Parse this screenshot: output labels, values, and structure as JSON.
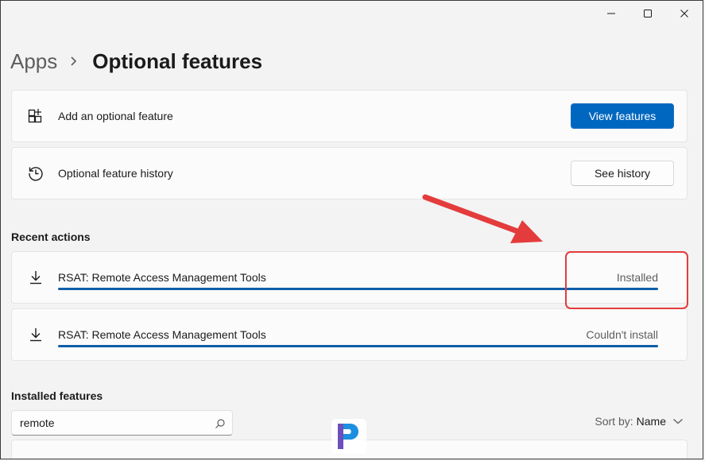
{
  "window": {
    "controls": [
      "minimize",
      "maximize",
      "close"
    ]
  },
  "breadcrumb": {
    "parent": "Apps",
    "separator_icon": "chevron-right-icon",
    "current": "Optional features"
  },
  "add_feature": {
    "icon": "add-grid-icon",
    "label": "Add an optional feature",
    "button_label": "View features"
  },
  "history": {
    "icon": "history-icon",
    "label": "Optional feature history",
    "button_label": "See history"
  },
  "recent_actions": {
    "title": "Recent actions",
    "items": [
      {
        "icon": "download-icon",
        "name": "RSAT: Remote Access Management Tools",
        "status": "Installed",
        "progress": 1.0
      },
      {
        "icon": "download-icon",
        "name": "RSAT: Remote Access Management Tools",
        "status": "Couldn't install",
        "progress": 1.0
      }
    ]
  },
  "installed_features": {
    "title": "Installed features",
    "search": {
      "value": "remote",
      "icon": "search-icon"
    },
    "sort": {
      "label": "Sort by:",
      "value": "Name",
      "icon": "chevron-down-icon"
    }
  },
  "colors": {
    "accent": "#0067c0",
    "annotation": "#e43c3c",
    "progress": "#0f5ea8"
  }
}
